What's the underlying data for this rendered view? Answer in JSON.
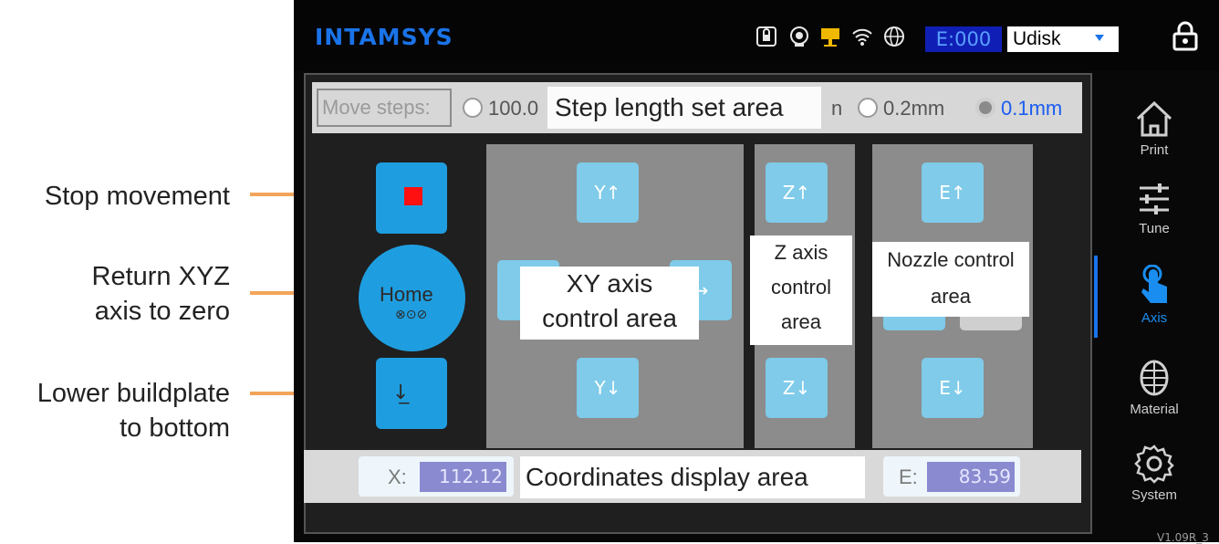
{
  "callouts": {
    "stop": "Stop movement",
    "home_line1": "Return XYZ",
    "home_line2": "axis to zero",
    "lower_line1": "Lower buildplate",
    "lower_line2": "to bottom"
  },
  "header": {
    "logo": "INTAMSYS",
    "status_icons": [
      "usb-lock-icon",
      "camera-icon",
      "network-icon",
      "wifi-icon",
      "globe-icon"
    ],
    "error_counter": "E:000",
    "storage_select": "Udisk"
  },
  "steps": {
    "label": "Move steps:",
    "area_label": "Step length set area",
    "options": [
      {
        "label": "100.0",
        "selected": false
      },
      {
        "label": "n",
        "selected": false
      },
      {
        "label": "0.2mm",
        "selected": false
      },
      {
        "label": "0.1mm",
        "selected": true
      }
    ]
  },
  "left_controls": {
    "home_label": "Home",
    "home_sub": "⊗⊙⊘",
    "lower_label": "↓̲"
  },
  "xy": {
    "up": "Y↑",
    "down": "Y↓",
    "left": "←",
    "right": "→",
    "area_label_line1": "XY axis",
    "area_label_line2": "control area"
  },
  "z": {
    "up": "Z↑",
    "down": "Z↓",
    "area_label_line1": "Z axis",
    "area_label_line2": "control",
    "area_label_line3": "area"
  },
  "nozzle": {
    "up": "E↑",
    "down": "E↓",
    "area_label_line1": "Nozzle control",
    "area_label_line2": "area"
  },
  "coords": {
    "x_label": "X:",
    "x_value": "112.12",
    "e_label": "E:",
    "e_value": "83.59",
    "area_label": "Coordinates display area"
  },
  "nav": {
    "items": [
      {
        "label": "Print",
        "icon": "home-icon",
        "active": false
      },
      {
        "label": "Tune",
        "icon": "sliders-icon",
        "active": false
      },
      {
        "label": "Axis",
        "icon": "hand-pointer-icon",
        "active": true
      },
      {
        "label": "Material",
        "icon": "spool-icon",
        "active": false
      },
      {
        "label": "System",
        "icon": "gear-icon",
        "active": false
      }
    ],
    "version": "V1.09R_3"
  },
  "colors": {
    "accent": "#1e9ee0",
    "arrow": "#f2a45a",
    "brand": "#1a73e8"
  }
}
